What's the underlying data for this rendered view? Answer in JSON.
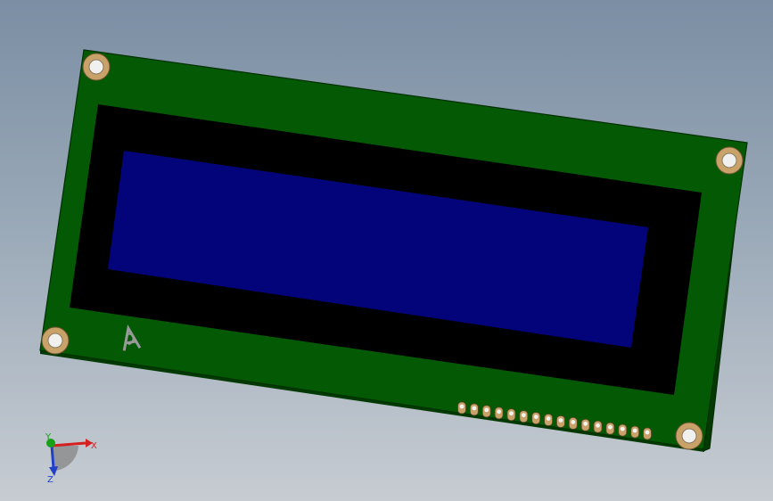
{
  "scene": {
    "background_top": "#7b8ea3",
    "background_bottom": "#c7ccd2"
  },
  "lcd_module": {
    "pcb_color": "#045a04",
    "bezel_color": "#000000",
    "display_color": "#04047a",
    "mounting_holes": 4,
    "silkscreen_marking": "A",
    "header_pins": 16
  },
  "triad": {
    "x_label": "X",
    "y_label": "Y",
    "z_label": "Z",
    "x_color": "#d42020",
    "y_color": "#18a018",
    "z_color": "#2040c8"
  }
}
